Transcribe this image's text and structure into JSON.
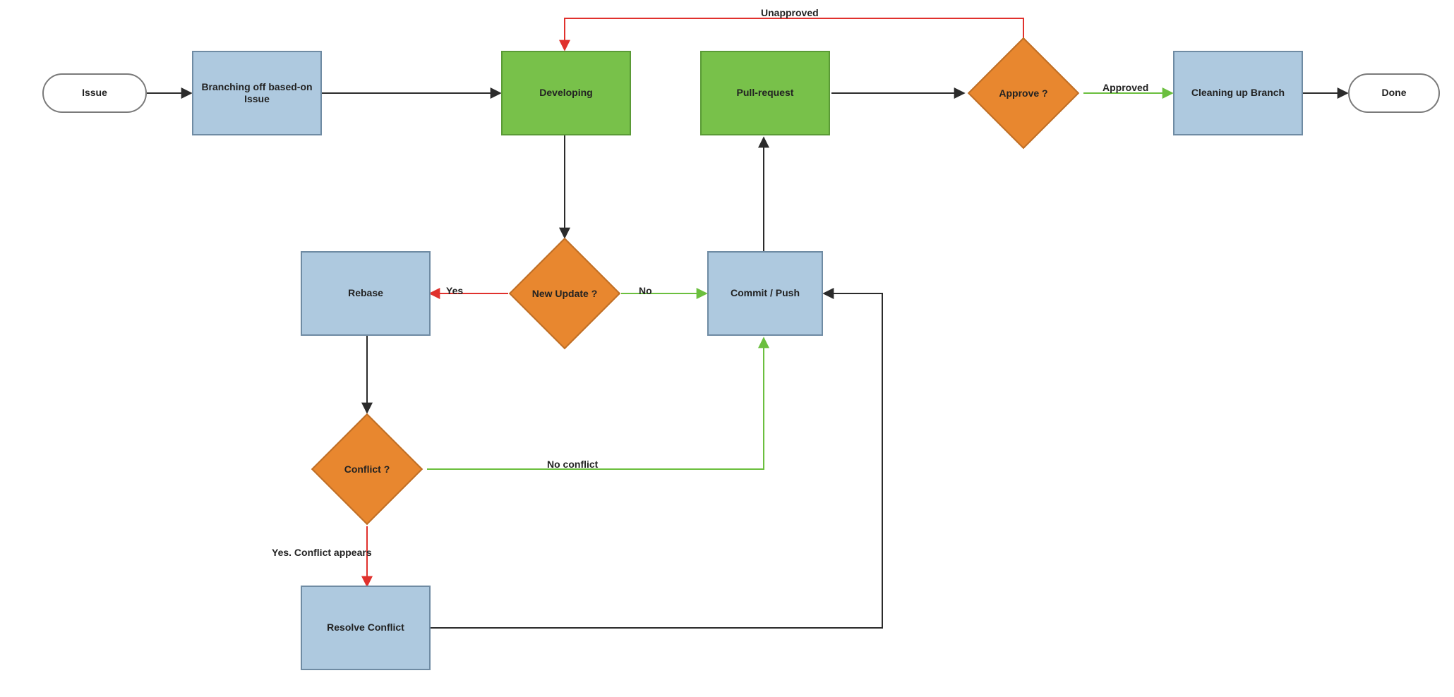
{
  "nodes": {
    "issue": "Issue",
    "branching": "Branching off based-on Issue",
    "developing": "Developing",
    "pull_request": "Pull-request",
    "approve": "Approve ?",
    "cleaning": "Cleaning up Branch",
    "done": "Done",
    "rebase": "Rebase",
    "new_update": "New Update ?",
    "commit_push": "Commit / Push",
    "conflict": "Conflict ?",
    "resolve_conflict": "Resolve Conflict"
  },
  "edge_labels": {
    "unapproved": "Unapproved",
    "approved": "Approved",
    "yes": "Yes",
    "no": "No",
    "no_conflict": "No conflict",
    "yes_conflict": "Yes. Conflict appears"
  },
  "colors": {
    "blue_fill": "#aec9df",
    "blue_border": "#6f8ba3",
    "green_fill": "#78c14a",
    "green_border": "#5a9a36",
    "orange_fill": "#e8872f",
    "orange_border": "#bf6e25",
    "arrow_black": "#2b2b2b",
    "arrow_red": "#e0312d",
    "arrow_green": "#6bbf3e"
  }
}
